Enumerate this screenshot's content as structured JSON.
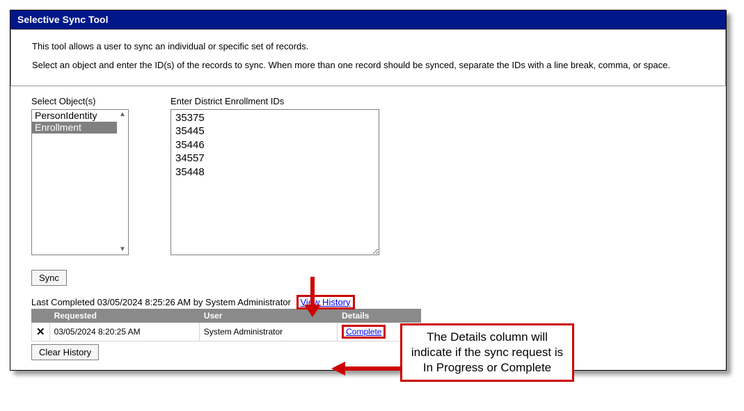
{
  "header": {
    "title": "Selective Sync Tool"
  },
  "intro": {
    "line1": "This tool allows a user to sync an individual or specific set of records.",
    "line2": "Select an object and enter the ID(s) of the records to sync. When more than one record should be synced, separate the IDs with a line break, comma, or space."
  },
  "form": {
    "objects_label": "Select Object(s)",
    "ids_label": "Enter District Enrollment IDs",
    "objects": {
      "opt0": "PersonIdentity",
      "opt1": "Enrollment"
    },
    "ids_value": "35375\n35445\n35446\n34557\n35448"
  },
  "buttons": {
    "sync": "Sync",
    "clear_history": "Clear History"
  },
  "status": {
    "last_completed": "Last Completed 03/05/2024 8:25:26 AM by System Administrator",
    "view_history": "View History"
  },
  "history": {
    "col_requested": "Requested",
    "col_user": "User",
    "col_details": "Details",
    "row0": {
      "requested": "03/05/2024 8:20:25 AM",
      "user": "System Administrator",
      "details": "Complete"
    }
  },
  "annotation": {
    "callout": "The Details column will indicate if the sync request is In Progress or Complete"
  }
}
